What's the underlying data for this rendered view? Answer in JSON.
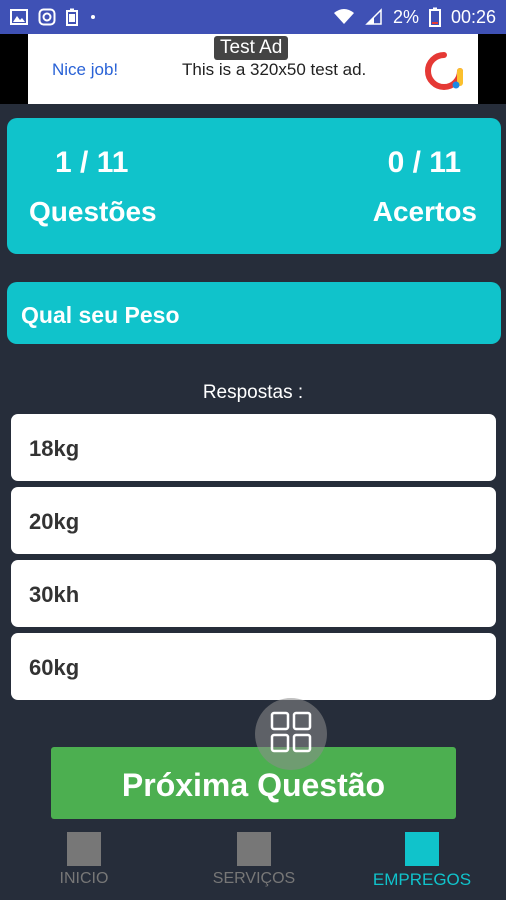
{
  "status_bar": {
    "battery": "2%",
    "time": "00:26",
    "left_icons": [
      "image-icon",
      "instagram-icon",
      "battery-saver-icon",
      "dot-icon"
    ],
    "right_icons": [
      "wifi-icon",
      "signal-icon",
      "battery-icon"
    ]
  },
  "ad": {
    "label": "Test Ad",
    "nice_job": "Nice job!",
    "text": "This is a 320x50 test ad.",
    "logo_icon": "admob-logo-icon"
  },
  "score": {
    "questions_value": "1 / 11",
    "questions_label": "Questões",
    "correct_value": "0 / 11",
    "correct_label": "Acertos"
  },
  "question": {
    "text": "Qual seu Peso"
  },
  "answers_label": "Respostas :",
  "answers": [
    "18kg",
    "20kg",
    "30kh",
    "60kg"
  ],
  "next_button": "Próxima Questão",
  "floating_button_icon": "grid-icon",
  "nav": {
    "items": [
      {
        "label": "INICIO",
        "active": false
      },
      {
        "label": "SERVIÇOS",
        "active": false
      },
      {
        "label": "EMPREGOS",
        "active": true
      }
    ]
  },
  "colors": {
    "accent": "#10c3cb",
    "background": "#262d3a",
    "status_bar": "#3f51b5",
    "next_button": "#4caf50",
    "nav_inactive": "#777777"
  }
}
